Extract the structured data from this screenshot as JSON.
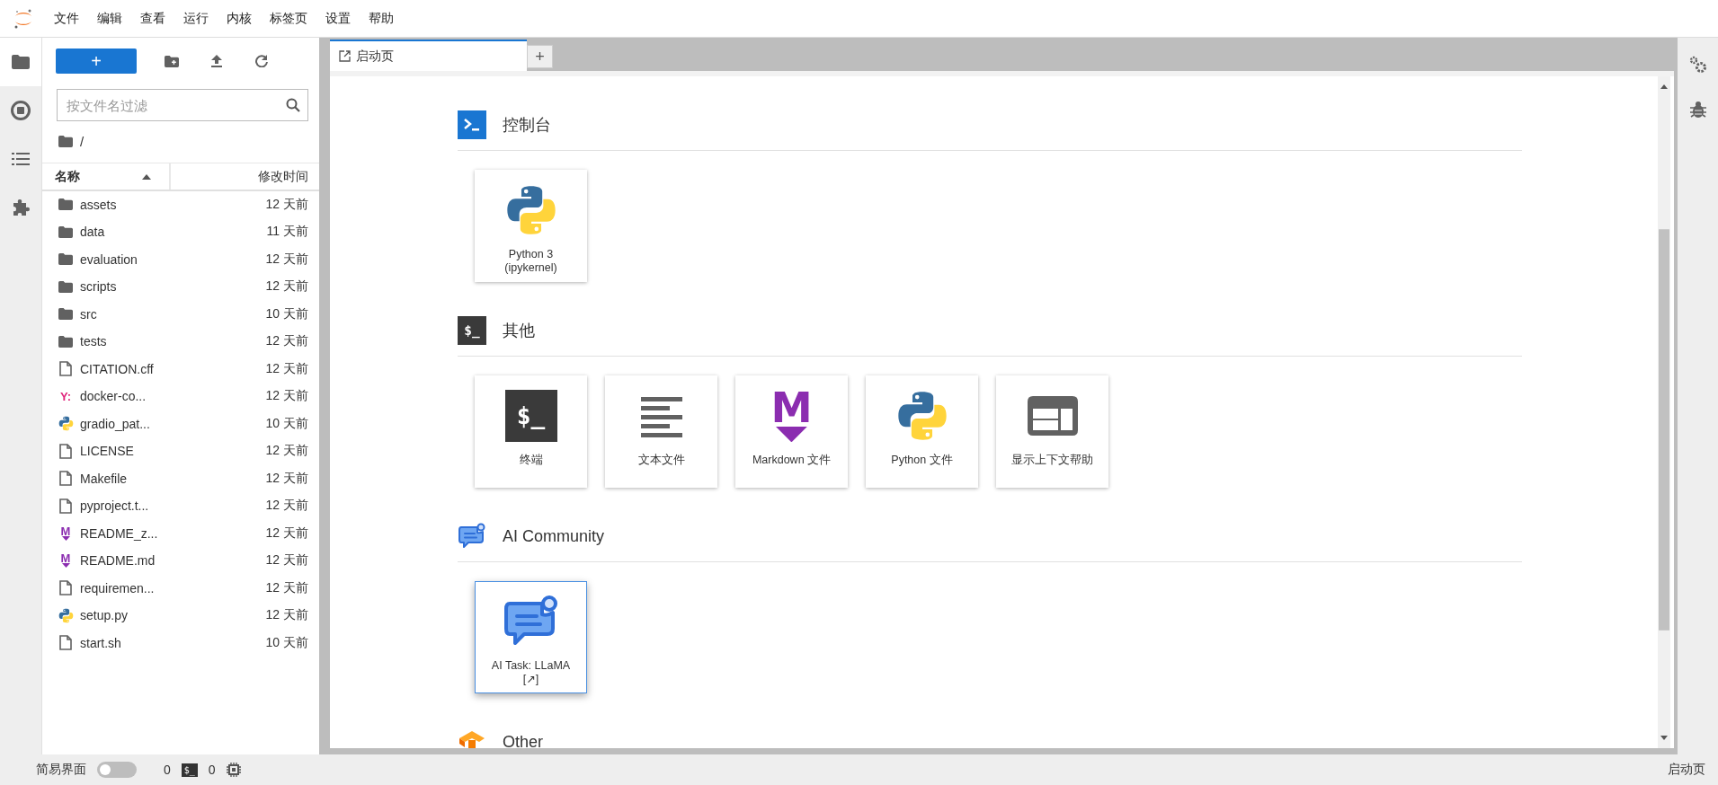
{
  "menu": [
    "文件",
    "编辑",
    "查看",
    "运行",
    "内核",
    "标签页",
    "设置",
    "帮助"
  ],
  "activity_bar": [
    {
      "kind": "folder",
      "selected": true
    },
    {
      "kind": "stop",
      "selected": false
    },
    {
      "kind": "list",
      "selected": false
    },
    {
      "kind": "puzzle",
      "selected": false
    }
  ],
  "file_browser": {
    "new_button": "+",
    "filter": {
      "placeholder": "按文件名过滤"
    },
    "path": "/",
    "columns": [
      {
        "label": "名称",
        "sorted": true
      },
      {
        "label": "修改时间",
        "sorted": false
      }
    ],
    "files": [
      {
        "name": "assets",
        "modified": "12 天前",
        "kind": "folder"
      },
      {
        "name": "data",
        "modified": "11 天前",
        "kind": "folder"
      },
      {
        "name": "evaluation",
        "modified": "12 天前",
        "kind": "folder"
      },
      {
        "name": "scripts",
        "modified": "12 天前",
        "kind": "folder"
      },
      {
        "name": "src",
        "modified": "10 天前",
        "kind": "folder"
      },
      {
        "name": "tests",
        "modified": "12 天前",
        "kind": "folder"
      },
      {
        "name": "CITATION.cff",
        "modified": "12 天前",
        "kind": "file"
      },
      {
        "name": "docker-co...",
        "modified": "12 天前",
        "kind": "yaml",
        "glyph": "Y:"
      },
      {
        "name": "gradio_pat...",
        "modified": "10 天前",
        "kind": "python"
      },
      {
        "name": "LICENSE",
        "modified": "12 天前",
        "kind": "file"
      },
      {
        "name": "Makefile",
        "modified": "12 天前",
        "kind": "file"
      },
      {
        "name": "pyproject.t...",
        "modified": "12 天前",
        "kind": "file"
      },
      {
        "name": "README_z...",
        "modified": "12 天前",
        "kind": "markdown",
        "glyph": "M"
      },
      {
        "name": "README.md",
        "modified": "12 天前",
        "kind": "markdown",
        "glyph": "M"
      },
      {
        "name": "requiremen...",
        "modified": "12 天前",
        "kind": "file"
      },
      {
        "name": "setup.py",
        "modified": "12 天前",
        "kind": "python"
      },
      {
        "name": "start.sh",
        "modified": "10 天前",
        "kind": "file"
      }
    ]
  },
  "tabs": [
    {
      "label": "启动页",
      "selected": true
    }
  ],
  "add_tab": "+",
  "launcher": {
    "sections": [
      {
        "title": "控制台",
        "kind": "console",
        "cards": [
          {
            "label": "Python 3\n(ipykernel)",
            "kind": "python",
            "selected": false
          }
        ]
      },
      {
        "title": "其他",
        "kind": "terminal",
        "glyph": "$_",
        "cards": [
          {
            "label": "终端",
            "kind": "terminal",
            "glyph": "$_",
            "selected": false
          },
          {
            "label": "文本文件",
            "kind": "text",
            "selected": false
          },
          {
            "label": "Markdown 文件",
            "kind": "markdown",
            "glyph": "M",
            "selected": false
          },
          {
            "label": "Python 文件",
            "kind": "python",
            "selected": false
          },
          {
            "label": "显示上下文帮助",
            "kind": "help",
            "selected": false
          }
        ]
      },
      {
        "title": "AI Community",
        "kind": "chat",
        "cards": [
          {
            "label": "AI Task: LLaMA\n[↗]",
            "kind": "chat",
            "selected": true
          }
        ]
      },
      {
        "title": "Other",
        "kind": "blocks"
      }
    ]
  },
  "status_bar": {
    "simple_mode": {
      "label": "简易界面",
      "on": false
    },
    "kernels": "0",
    "terminals": {
      "glyph": "$_",
      "count": "0"
    },
    "right": "启动页"
  }
}
